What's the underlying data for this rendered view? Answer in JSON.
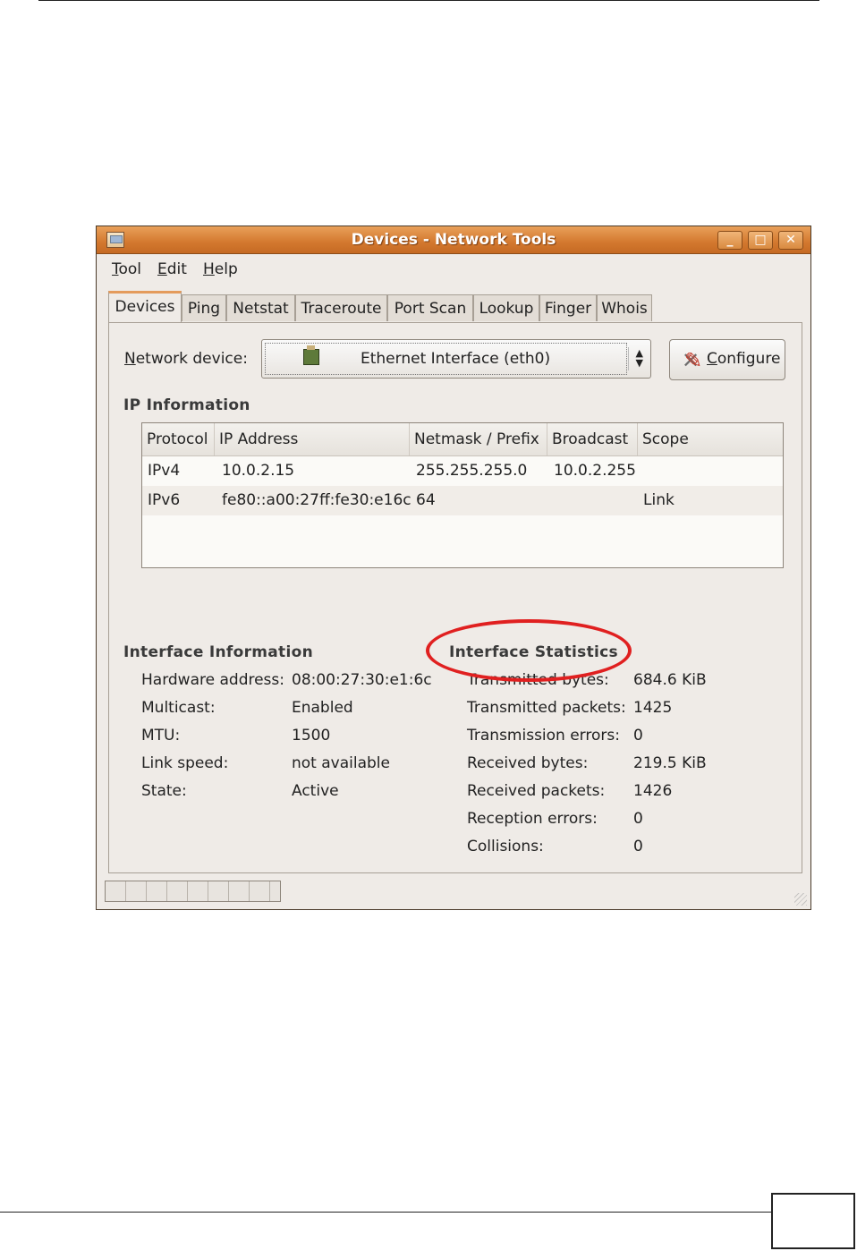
{
  "window": {
    "title": "Devices - Network Tools",
    "controls": {
      "minimize": "_",
      "maximize": "□",
      "close": "✕"
    }
  },
  "menubar": [
    {
      "label": "Tool",
      "mnemonic": "T",
      "rest": "ool"
    },
    {
      "label": "Edit",
      "mnemonic": "E",
      "rest": "dit"
    },
    {
      "label": "Help",
      "mnemonic": "H",
      "rest": "elp"
    }
  ],
  "tabs": [
    "Devices",
    "Ping",
    "Netstat",
    "Traceroute",
    "Port Scan",
    "Lookup",
    "Finger",
    "Whois"
  ],
  "active_tab": "Devices",
  "device": {
    "label_mnemonic": "N",
    "label_rest": "etwork device:",
    "selected": "Ethernet Interface (eth0)",
    "icon": "network-card-icon",
    "configure_mnemonic": "C",
    "configure_rest": "onfigure",
    "configure_icon": "tools-icon"
  },
  "ip_info": {
    "heading": "IP Information",
    "columns": [
      "Protocol",
      "IP Address",
      "Netmask / Prefix",
      "Broadcast",
      "Scope"
    ],
    "rows": [
      [
        "IPv4",
        "10.0.2.15",
        "255.255.255.0",
        "10.0.2.255",
        ""
      ],
      [
        "IPv6",
        "fe80::a00:27ff:fe30:e16c",
        "64",
        "",
        "Link"
      ]
    ]
  },
  "interface_info": {
    "heading": "Interface Information",
    "rows": [
      {
        "label": "Hardware address:",
        "value": "08:00:27:30:e1:6c"
      },
      {
        "label": "Multicast:",
        "value": "Enabled"
      },
      {
        "label": "MTU:",
        "value": "1500"
      },
      {
        "label": "Link speed:",
        "value": "not available"
      },
      {
        "label": "State:",
        "value": "Active"
      }
    ]
  },
  "interface_stats": {
    "heading": "Interface Statistics",
    "rows": [
      {
        "label": "Transmitted bytes:",
        "value": "684.6 KiB"
      },
      {
        "label": "Transmitted packets:",
        "value": "1425"
      },
      {
        "label": "Transmission errors:",
        "value": "0"
      },
      {
        "label": "Received bytes:",
        "value": "219.5 KiB"
      },
      {
        "label": "Received packets:",
        "value": "1426"
      },
      {
        "label": "Reception errors:",
        "value": "0"
      },
      {
        "label": "Collisions:",
        "value": "0"
      }
    ]
  },
  "annotation": {
    "color": "#e02020",
    "target": "Interface Statistics"
  },
  "colors": {
    "titlebar": "#d3782e",
    "window_bg": "#efebe7",
    "active_tab_accent": "#e49b5c"
  }
}
